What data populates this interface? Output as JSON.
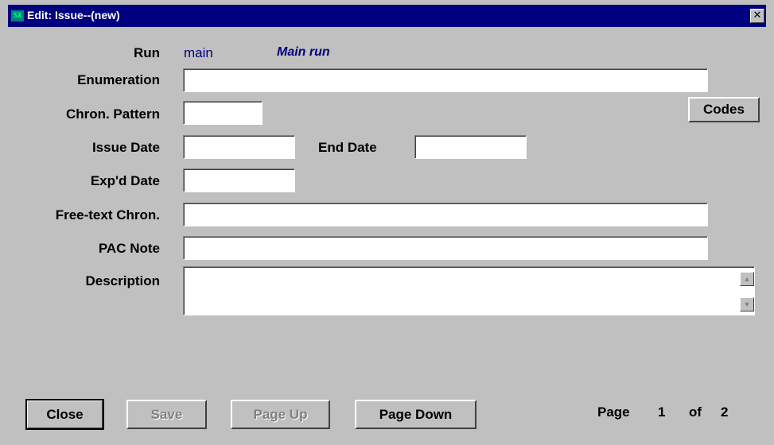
{
  "window": {
    "title": "Edit: Issue--(new)",
    "close_glyph": "✕",
    "icon": "app-icon"
  },
  "fields": {
    "run": {
      "label": "Run",
      "value": "main",
      "description": "Main run"
    },
    "enumeration": {
      "label": "Enumeration",
      "value": ""
    },
    "chron_pattern": {
      "label": "Chron. Pattern",
      "value": ""
    },
    "issue_date": {
      "label": "Issue Date",
      "value": ""
    },
    "end_date": {
      "label": "End Date",
      "value": ""
    },
    "expd_date": {
      "label": "Exp'd Date",
      "value": ""
    },
    "free_text_chron": {
      "label": "Free-text Chron.",
      "value": ""
    },
    "pac_note": {
      "label": "PAC Note",
      "value": ""
    },
    "description": {
      "label": "Description",
      "value": ""
    }
  },
  "buttons": {
    "codes": "Codes",
    "close": "Close",
    "save": "Save",
    "page_up": "Page Up",
    "page_down": "Page Down"
  },
  "pager": {
    "page_label": "Page",
    "current": "1",
    "of_label": "of",
    "total": "2"
  },
  "colors": {
    "titlebar": "#000080",
    "background": "#c0c0c0",
    "value_text": "#000080"
  }
}
